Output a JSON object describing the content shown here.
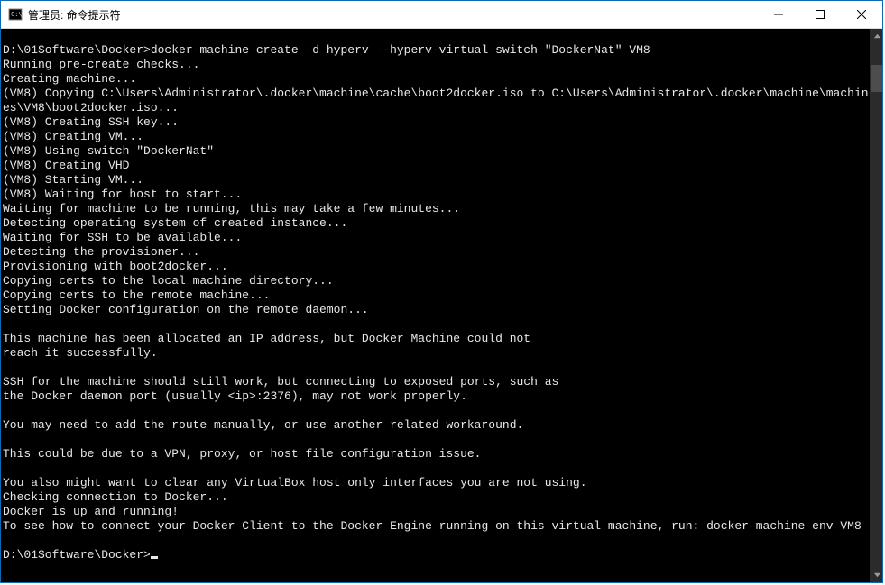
{
  "window": {
    "title": "管理员: 命令提示符"
  },
  "terminal": {
    "blank_top": " ",
    "lines": [
      "D:\\01Software\\Docker>docker-machine create -d hyperv --hyperv-virtual-switch \"DockerNat\" VM8",
      "Running pre-create checks...",
      "Creating machine...",
      "(VM8) Copying C:\\Users\\Administrator\\.docker\\machine\\cache\\boot2docker.iso to C:\\Users\\Administrator\\.docker\\machine\\machines\\VM8\\boot2docker.iso...",
      "(VM8) Creating SSH key...",
      "(VM8) Creating VM...",
      "(VM8) Using switch \"DockerNat\"",
      "(VM8) Creating VHD",
      "(VM8) Starting VM...",
      "(VM8) Waiting for host to start...",
      "Waiting for machine to be running, this may take a few minutes...",
      "Detecting operating system of created instance...",
      "Waiting for SSH to be available...",
      "Detecting the provisioner...",
      "Provisioning with boot2docker...",
      "Copying certs to the local machine directory...",
      "Copying certs to the remote machine...",
      "Setting Docker configuration on the remote daemon...",
      "",
      "This machine has been allocated an IP address, but Docker Machine could not",
      "reach it successfully.",
      "",
      "SSH for the machine should still work, but connecting to exposed ports, such as",
      "the Docker daemon port (usually <ip>:2376), may not work properly.",
      "",
      "You may need to add the route manually, or use another related workaround.",
      "",
      "This could be due to a VPN, proxy, or host file configuration issue.",
      "",
      "You also might want to clear any VirtualBox host only interfaces you are not using.",
      "Checking connection to Docker...",
      "Docker is up and running!",
      "To see how to connect your Docker Client to the Docker Engine running on this virtual machine, run: docker-machine env VM8",
      ""
    ],
    "prompt": "D:\\01Software\\Docker>"
  }
}
